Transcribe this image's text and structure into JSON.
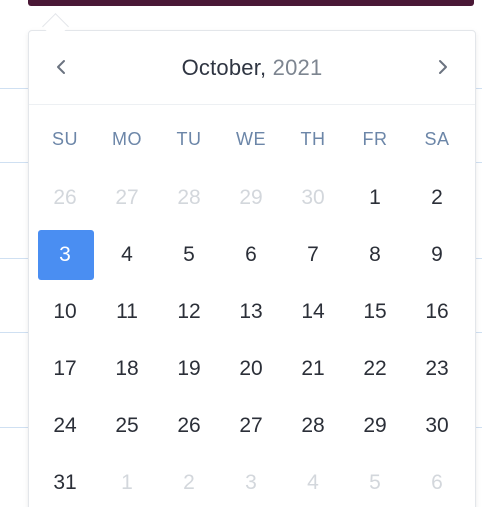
{
  "calendar": {
    "month": "October,",
    "year": "2021",
    "prev_icon": "chevron-left-icon",
    "next_icon": "chevron-right-icon",
    "accent_color": "#4a8ef2",
    "weekdays": [
      "SU",
      "MO",
      "TU",
      "WE",
      "TH",
      "FR",
      "SA"
    ],
    "selected_day": "3",
    "weeks": [
      [
        {
          "d": "26",
          "m": true
        },
        {
          "d": "27",
          "m": true
        },
        {
          "d": "28",
          "m": true
        },
        {
          "d": "29",
          "m": true
        },
        {
          "d": "30",
          "m": true
        },
        {
          "d": "1",
          "m": false
        },
        {
          "d": "2",
          "m": false
        }
      ],
      [
        {
          "d": "3",
          "m": false,
          "s": true
        },
        {
          "d": "4",
          "m": false
        },
        {
          "d": "5",
          "m": false
        },
        {
          "d": "6",
          "m": false
        },
        {
          "d": "7",
          "m": false
        },
        {
          "d": "8",
          "m": false
        },
        {
          "d": "9",
          "m": false
        }
      ],
      [
        {
          "d": "10",
          "m": false
        },
        {
          "d": "11",
          "m": false
        },
        {
          "d": "12",
          "m": false
        },
        {
          "d": "13",
          "m": false
        },
        {
          "d": "14",
          "m": false
        },
        {
          "d": "15",
          "m": false
        },
        {
          "d": "16",
          "m": false
        }
      ],
      [
        {
          "d": "17",
          "m": false
        },
        {
          "d": "18",
          "m": false
        },
        {
          "d": "19",
          "m": false
        },
        {
          "d": "20",
          "m": false
        },
        {
          "d": "21",
          "m": false
        },
        {
          "d": "22",
          "m": false
        },
        {
          "d": "23",
          "m": false
        }
      ],
      [
        {
          "d": "24",
          "m": false
        },
        {
          "d": "25",
          "m": false
        },
        {
          "d": "26",
          "m": false
        },
        {
          "d": "27",
          "m": false
        },
        {
          "d": "28",
          "m": false
        },
        {
          "d": "29",
          "m": false
        },
        {
          "d": "30",
          "m": false
        }
      ],
      [
        {
          "d": "31",
          "m": false
        },
        {
          "d": "1",
          "m": true
        },
        {
          "d": "2",
          "m": true
        },
        {
          "d": "3",
          "m": true
        },
        {
          "d": "4",
          "m": true
        },
        {
          "d": "5",
          "m": true
        },
        {
          "d": "6",
          "m": true
        }
      ]
    ]
  }
}
